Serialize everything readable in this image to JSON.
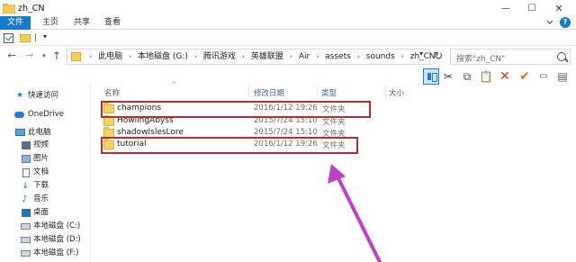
{
  "window": {
    "title": "zh_CN"
  },
  "ribbon": {
    "tabs": [
      "文件",
      "主页",
      "共享",
      "查看"
    ],
    "help": "?"
  },
  "quick_access": {
    "dropdown": "▾"
  },
  "address": {
    "segments": [
      "此电脑",
      "本地磁盘 (G:)",
      "腾讯游戏",
      "英雄联盟",
      "Air",
      "assets",
      "sounds",
      "zh_CN"
    ]
  },
  "search": {
    "placeholder": "搜索\"zh_CN\""
  },
  "sidebar": {
    "items": [
      {
        "label": "快速访问",
        "icon": "star-icon"
      },
      {
        "label": "OneDrive",
        "icon": "cloud-icon"
      },
      {
        "label": "此电脑",
        "icon": "computer-icon"
      },
      {
        "label": "视频",
        "icon": "video-icon"
      },
      {
        "label": "图片",
        "icon": "picture-icon"
      },
      {
        "label": "文档",
        "icon": "document-icon"
      },
      {
        "label": "下载",
        "icon": "download-icon"
      },
      {
        "label": "音乐",
        "icon": "music-icon"
      },
      {
        "label": "桌面",
        "icon": "desktop-icon"
      },
      {
        "label": "本地磁盘 (C:)",
        "icon": "drive-icon"
      },
      {
        "label": "本地磁盘 (D:)",
        "icon": "drive-icon"
      },
      {
        "label": "本地磁盘 (F:)",
        "icon": "drive-icon"
      }
    ]
  },
  "file_list": {
    "columns": [
      "名称",
      "修改日期",
      "类型",
      "大小"
    ],
    "rows": [
      {
        "name": "champions",
        "date": "2016/1/12 19:26",
        "type": "文件夹"
      },
      {
        "name": "HowlingAbyss",
        "date": "2015/7/24 15:10",
        "type": "文件夹"
      },
      {
        "name": "shadowIslesLore",
        "date": "2015/7/24 15:10",
        "type": "文件夹"
      },
      {
        "name": "tutorial",
        "date": "2016/1/12 19:26",
        "type": "文件夹"
      }
    ]
  },
  "colors": {
    "accent": "#1979ca",
    "highlight_box": "#b12f33",
    "annotation_arrow": "#c040c8",
    "folder": "#f7d468"
  }
}
